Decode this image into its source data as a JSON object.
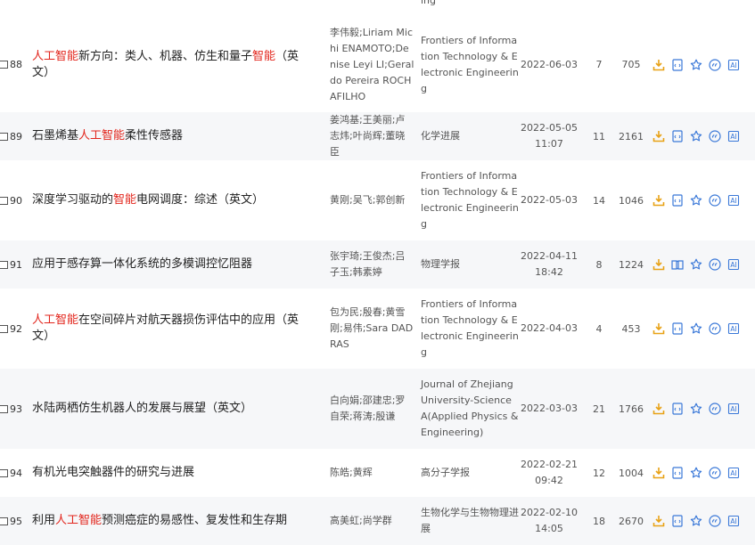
{
  "colors": {
    "highlight": "#e2261d",
    "icon_orange": "#e8a217",
    "icon_blue": "#3a78d8",
    "row_alt": "#f6f7f9"
  },
  "top_partial": {
    "source_tail": "ing"
  },
  "rows": [
    {
      "number": "88",
      "title_parts": [
        {
          "text": "人工智能",
          "hl": true
        },
        {
          "text": "新方向：类人、机器、仿生和量子",
          "hl": false
        },
        {
          "text": "智能",
          "hl": true
        },
        {
          "text": "（英文）",
          "hl": false
        }
      ],
      "authors": "李伟毅;Liriam Michi ENAMOTO;Denise Leyi LI;Geraldo Pereira ROCHAFILHO",
      "source": "Frontiers of Information Technology & Electronic Engineering",
      "date": "2022-06-03",
      "time": "",
      "cited": "7",
      "downloads": "705",
      "icons": [
        "download-icon",
        "html-icon",
        "favorite-icon",
        "quote-icon",
        "ai-icon"
      ]
    },
    {
      "number": "89",
      "title_parts": [
        {
          "text": "石墨烯基",
          "hl": false
        },
        {
          "text": "人工智能",
          "hl": true
        },
        {
          "text": "柔性传感器",
          "hl": false
        }
      ],
      "authors": "姜鸿基;王美丽;卢志炜;叶尚辉;董晓臣",
      "source": "化学进展",
      "date": "2022-05-05",
      "time": "11:07",
      "cited": "11",
      "downloads": "2161",
      "icons": [
        "download-icon",
        "html-icon",
        "favorite-icon",
        "quote-icon",
        "ai-icon"
      ]
    },
    {
      "number": "90",
      "title_parts": [
        {
          "text": "深度学习驱动的",
          "hl": false
        },
        {
          "text": "智能",
          "hl": true
        },
        {
          "text": "电网调度：综述（英文）",
          "hl": false
        }
      ],
      "authors": "黄刚;吴飞;郭创新",
      "source": "Frontiers of Information Technology & Electronic Engineering",
      "date": "2022-05-03",
      "time": "",
      "cited": "14",
      "downloads": "1046",
      "icons": [
        "download-icon",
        "html-icon",
        "favorite-icon",
        "quote-icon",
        "ai-icon"
      ]
    },
    {
      "number": "91",
      "title_parts": [
        {
          "text": "应用于感存算一体化系统的多模调控忆阻器",
          "hl": false
        }
      ],
      "authors": "张宇琦;王俊杰;吕子玉;韩素婷",
      "source": "物理学报",
      "date": "2022-04-11",
      "time": "18:42",
      "cited": "8",
      "downloads": "1224",
      "icons": [
        "download-icon",
        "read-icon",
        "favorite-icon",
        "quote-icon",
        "ai-icon"
      ]
    },
    {
      "number": "92",
      "title_parts": [
        {
          "text": "人工智能",
          "hl": true
        },
        {
          "text": "在空间碎片对航天器损伤评估中的应用（英文）",
          "hl": false
        }
      ],
      "authors": "包为民;殷春;黄雪刚;易伟;Sara DADRAS",
      "source": "Frontiers of Information Technology & Electronic Engineering",
      "date": "2022-04-03",
      "time": "",
      "cited": "4",
      "downloads": "453",
      "icons": [
        "download-icon",
        "html-icon",
        "favorite-icon",
        "quote-icon",
        "ai-icon"
      ]
    },
    {
      "number": "93",
      "title_parts": [
        {
          "text": "水陆两栖仿生机器人的发展与展望（英文）",
          "hl": false
        }
      ],
      "authors": "白向娟;邵建忠;罗自荣;蒋涛;殷谦",
      "source": "Journal of Zhejiang University-Science A(Applied Physics & Engineering)",
      "date": "2022-03-03",
      "time": "",
      "cited": "21",
      "downloads": "1766",
      "icons": [
        "download-icon",
        "html-icon",
        "favorite-icon",
        "quote-icon",
        "ai-icon"
      ]
    },
    {
      "number": "94",
      "title_parts": [
        {
          "text": "有机光电突触器件的研究与进展",
          "hl": false
        }
      ],
      "authors": "陈皓;黄辉",
      "source": "高分子学报",
      "date": "2022-02-21",
      "time": "09:42",
      "cited": "12",
      "downloads": "1004",
      "icons": [
        "download-icon",
        "html-icon",
        "favorite-icon",
        "quote-icon",
        "ai-icon"
      ]
    },
    {
      "number": "95",
      "title_parts": [
        {
          "text": "利用",
          "hl": false
        },
        {
          "text": "人工智能",
          "hl": true
        },
        {
          "text": "预测癌症的易感性、复发性和生存期",
          "hl": false
        }
      ],
      "authors": "高美虹;尚学群",
      "source": "生物化学与生物物理进展",
      "date": "2022-02-10",
      "time": "14:05",
      "cited": "18",
      "downloads": "2670",
      "icons": [
        "download-icon",
        "html-icon",
        "favorite-icon",
        "quote-icon",
        "ai-icon"
      ]
    }
  ]
}
